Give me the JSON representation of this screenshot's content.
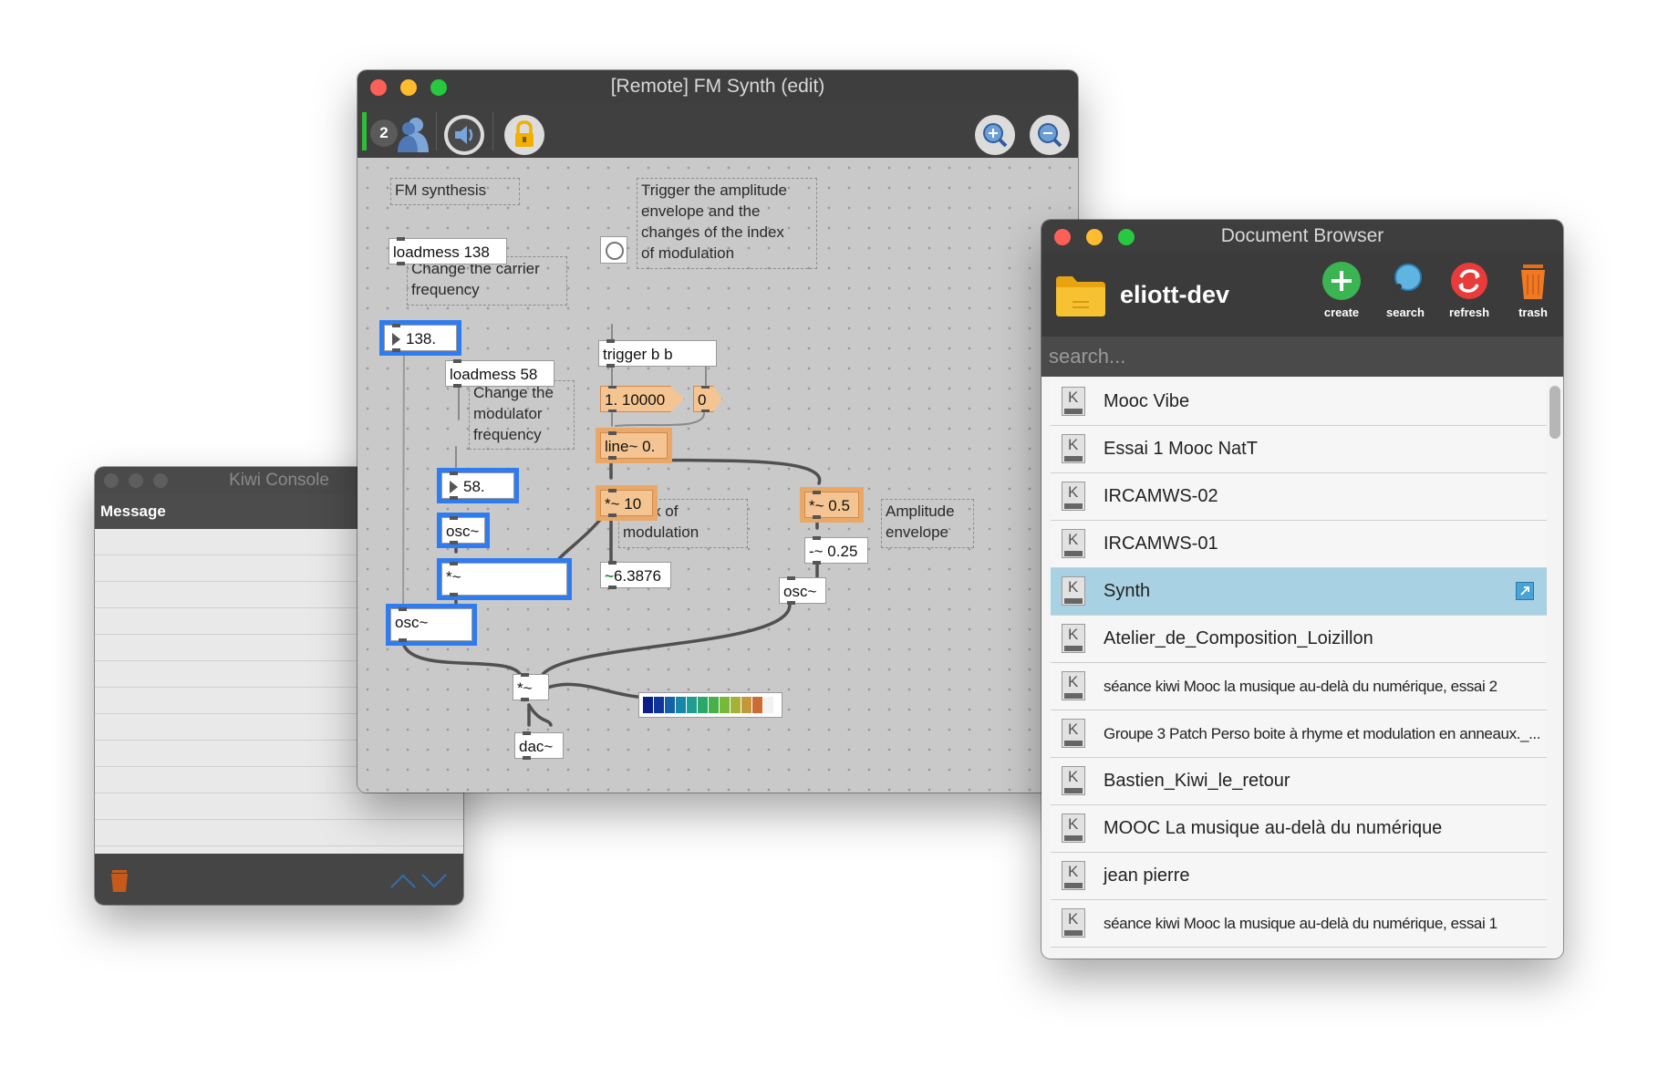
{
  "console": {
    "title": "Kiwi Console",
    "column_header": "Message"
  },
  "patcher": {
    "title": "[Remote] FM Synth (edit)",
    "users_count": "2",
    "objects": {
      "loadmess138": "loadmess 138",
      "num138": "138.",
      "loadmess58": "loadmess 58",
      "num58": "58.",
      "osc_mod": "osc~",
      "mul_mod": "*~",
      "osc_carrier": "osc~",
      "mul_out": "*~",
      "dac": "dac~",
      "trigger": "trigger b b",
      "msg_1_10000": "1. 10000",
      "msg_0": "0",
      "line": "line~ 0.",
      "mul10": "*~ 10",
      "num_sig": "6.3876",
      "mul05": "*~ 0.5",
      "minus025": "-~ 0.25",
      "osc_env": "osc~"
    },
    "comments": {
      "fm": "FM synthesis",
      "carrier": "Change the carrier\nfrequency",
      "modulator": "Change the\nmodulator\nfrequency",
      "trigger": "Trigger the amplitude\nenvelope and the\nchanges of the index\nof modulation",
      "index": "Index of\nmodulation",
      "amp": "Amplitude\nenvelope"
    },
    "meter_level": 0.91
  },
  "browser": {
    "title": "Document Browser",
    "folder": "eliott-dev",
    "buttons": {
      "create": "create",
      "search": "search",
      "refresh": "refresh",
      "trash": "trash"
    },
    "search_placeholder": "search...",
    "documents": [
      {
        "name": "Mooc Vibe"
      },
      {
        "name": "Essai 1 Mooc NatT"
      },
      {
        "name": "IRCAMWS-02"
      },
      {
        "name": "IRCAMWS-01"
      },
      {
        "name": "Synth"
      },
      {
        "name": "Atelier_de_Composition_Loizillon"
      },
      {
        "name": "séance kiwi Mooc la musique au-delà du numérique, essai  2"
      },
      {
        "name": "Groupe 3 Patch Perso boite à rhyme et modulation en anneaux._..."
      },
      {
        "name": "Bastien_Kiwi_le_retour"
      },
      {
        "name": "MOOC La musique au-delà du numérique"
      },
      {
        "name": "jean pierre"
      },
      {
        "name": "séance kiwi Mooc la musique au-delà du numérique, essai  1"
      }
    ],
    "selected_index": 4
  }
}
